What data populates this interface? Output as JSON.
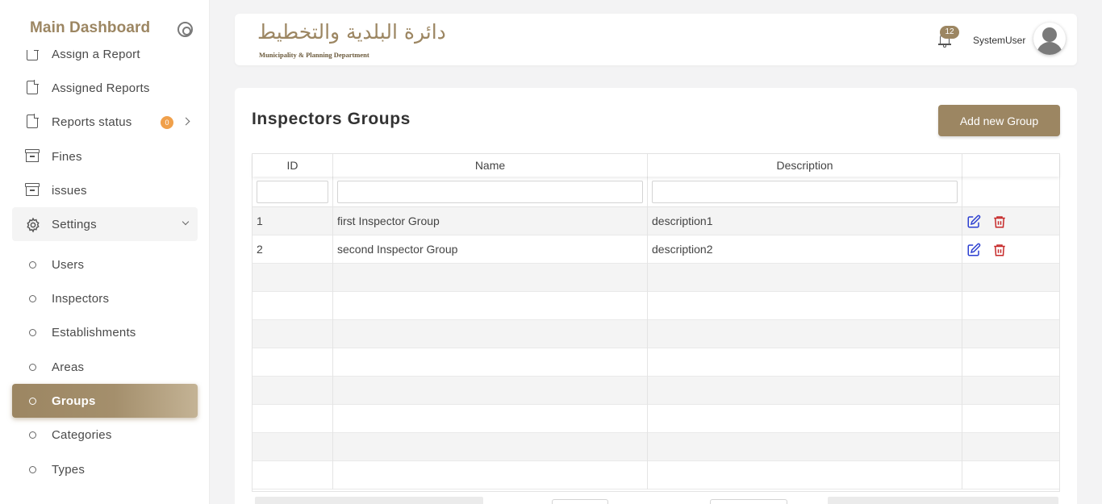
{
  "sidebar": {
    "brand": "Main Dashboard",
    "items": [
      {
        "label": "Assign a Report",
        "icon": "document-icon"
      },
      {
        "label": "Assigned Reports",
        "icon": "document-icon"
      },
      {
        "label": "Reports status",
        "icon": "document-icon",
        "badge": "0"
      },
      {
        "label": "Fines",
        "icon": "archive-icon"
      },
      {
        "label": "issues",
        "icon": "archive-icon"
      },
      {
        "label": "Settings",
        "icon": "gear-icon"
      }
    ],
    "settings_children": [
      {
        "label": "Users"
      },
      {
        "label": "Inspectors"
      },
      {
        "label": "Establishments"
      },
      {
        "label": "Areas"
      },
      {
        "label": "Groups",
        "active": true
      },
      {
        "label": "Categories"
      },
      {
        "label": "Types"
      }
    ]
  },
  "header": {
    "logo_arabic": "دائرة البلدية والتخطيط",
    "logo_english": "Municipality & Planning Department",
    "notifications_count": "12",
    "username": "SystemUser"
  },
  "main": {
    "title": "Inspectors Groups",
    "add_button": "Add new Group",
    "columns": [
      "ID",
      "Name",
      "Description",
      ""
    ],
    "rows": [
      {
        "id": "1",
        "name": "first Inspector Group",
        "description": "description1"
      },
      {
        "id": "2",
        "name": "second Inspector Group",
        "description": "description2"
      }
    ]
  },
  "colors": {
    "accent": "#9c8662",
    "badge_orange": "#f0a04b",
    "edit_blue": "#2b3fd1",
    "delete_red": "#c62828"
  }
}
